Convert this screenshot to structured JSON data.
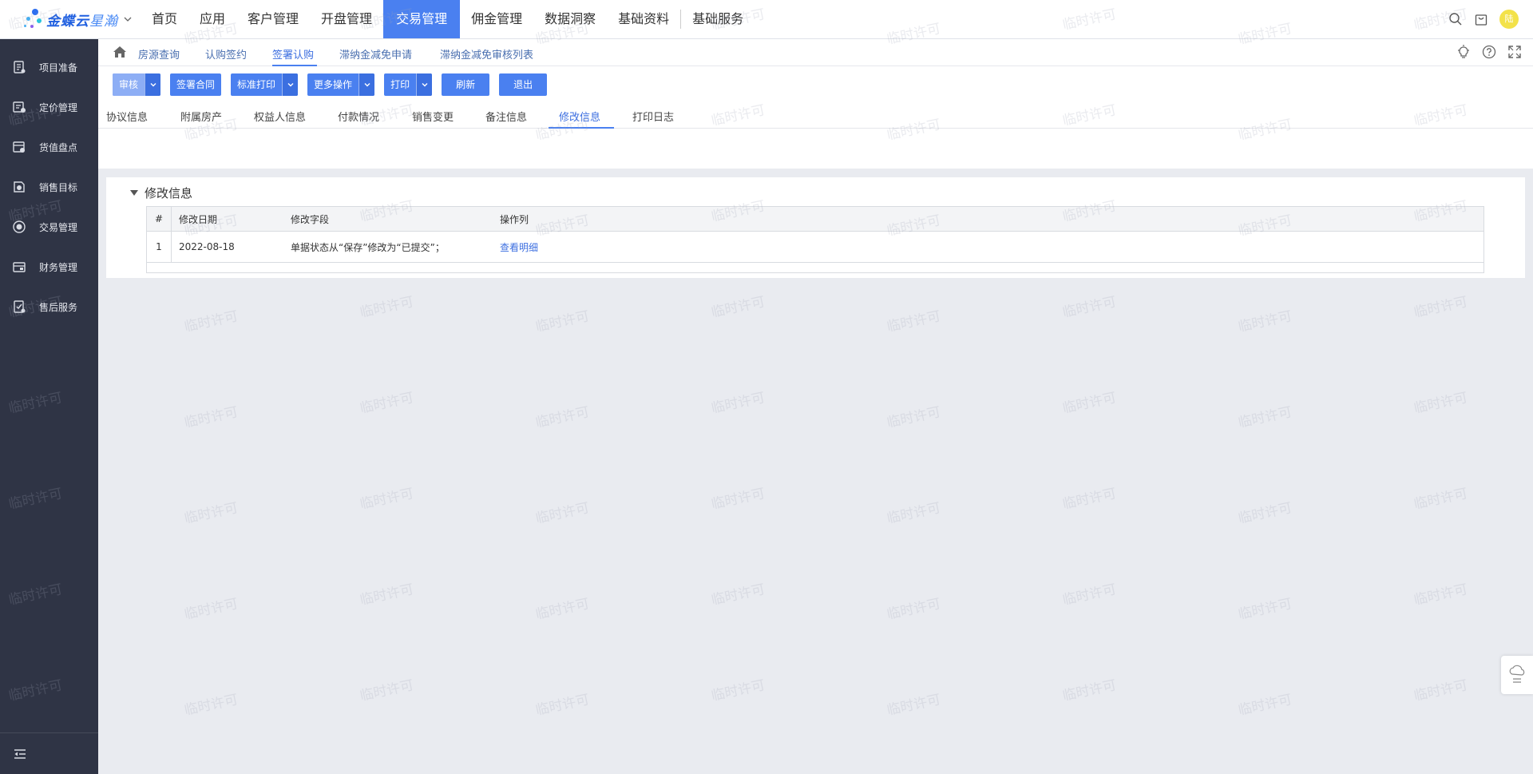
{
  "app": {
    "logo_text": "金蝶云",
    "logo_subtext": "星瀚"
  },
  "topnav": {
    "items": [
      {
        "label": "首页"
      },
      {
        "label": "应用"
      },
      {
        "label": "客户管理"
      },
      {
        "label": "开盘管理"
      },
      {
        "label": "交易管理",
        "active": true
      },
      {
        "label": "佣金管理"
      },
      {
        "label": "数据洞察"
      },
      {
        "label": "基础资料"
      },
      {
        "label": "基础服务"
      }
    ],
    "avatar_text": "陆"
  },
  "sidebar": {
    "items": [
      {
        "label": "项目准备",
        "icon": "project-prep-icon"
      },
      {
        "label": "定价管理",
        "icon": "pricing-icon"
      },
      {
        "label": "货值盘点",
        "icon": "inventory-icon"
      },
      {
        "label": "销售目标",
        "icon": "sales-target-icon"
      },
      {
        "label": "交易管理",
        "icon": "transaction-icon"
      },
      {
        "label": "财务管理",
        "icon": "finance-icon"
      },
      {
        "label": "售后服务",
        "icon": "after-sales-icon"
      }
    ]
  },
  "breadcrumb": {
    "items": [
      {
        "label": "房源查询"
      },
      {
        "label": "认购签约"
      },
      {
        "label": "签署认购",
        "active": true
      },
      {
        "label": "滞纳金减免申请"
      },
      {
        "label": "滞纳金减免审核列表"
      }
    ]
  },
  "toolbar": {
    "audit_label": "审核",
    "sign_contract_label": "签署合同",
    "standard_print_label": "标准打印",
    "more_actions_label": "更多操作",
    "print_label": "打印",
    "refresh_label": "刷新",
    "exit_label": "退出"
  },
  "tabs": {
    "items": [
      {
        "label": "协议信息"
      },
      {
        "label": "附属房产"
      },
      {
        "label": "权益人信息"
      },
      {
        "label": "付款情况"
      },
      {
        "label": "销售变更"
      },
      {
        "label": "备注信息"
      },
      {
        "label": "修改信息",
        "active": true
      },
      {
        "label": "打印日志"
      }
    ]
  },
  "section": {
    "title": "修改信息",
    "columns": [
      "#",
      "修改日期",
      "修改字段",
      "操作列"
    ],
    "rows": [
      {
        "index": "1",
        "date": "2022-08-18",
        "field": "单据状态从“保存”修改为“已提交”；",
        "action": "查看明细"
      }
    ]
  },
  "watermark": {
    "text": "临时许可"
  },
  "colors": {
    "primary": "#4a80f0",
    "sidebar_bg": "#2f3445",
    "page_bg": "#e9ebf0",
    "link": "#3d6fe0"
  }
}
